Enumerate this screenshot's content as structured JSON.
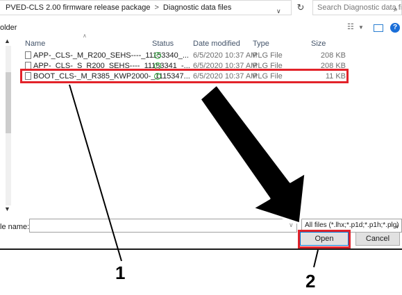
{
  "window": {
    "breadcrumb": [
      "PVED-CLS 2.00 firmware release package",
      "Diagnostic data files"
    ],
    "breadcrumb_sep": ">",
    "search_placeholder": "Search Diagnostic data files",
    "left_pane_label": "older"
  },
  "columns": {
    "name": "Name",
    "status": "Status",
    "date_modified": "Date modified",
    "type": "Type",
    "size": "Size"
  },
  "files": [
    {
      "name": "APP-_CLS-_M_R200_SEHS----_11153340_...",
      "status": "synced",
      "date": "6/5/2020 10:37 AM",
      "type": "PLG File",
      "size": "208 KB"
    },
    {
      "name": "APP-_CLS-_S_R200_SEHS----_11153341_-...",
      "status": "synced",
      "date": "6/5/2020 10:37 AM",
      "type": "PLG File",
      "size": "208 KB"
    },
    {
      "name": "BOOT_CLS-_M_R385_KWP2000-_1115347...",
      "status": "synced",
      "date": "6/5/2020 10:37 AM",
      "type": "PLG File",
      "size": "11 KB"
    }
  ],
  "footer": {
    "file_name_label": "le name:",
    "file_name_value": "",
    "filter": "All files (*.lhx;*.p1d;*.p1h;*.plg)",
    "open_label": "Open",
    "cancel_label": "Cancel"
  },
  "callouts": {
    "one": "1",
    "two": "2"
  },
  "colors": {
    "highlight": "#e2232a",
    "status_ok": "#2eaa3a",
    "help": "#1a6ed8"
  }
}
